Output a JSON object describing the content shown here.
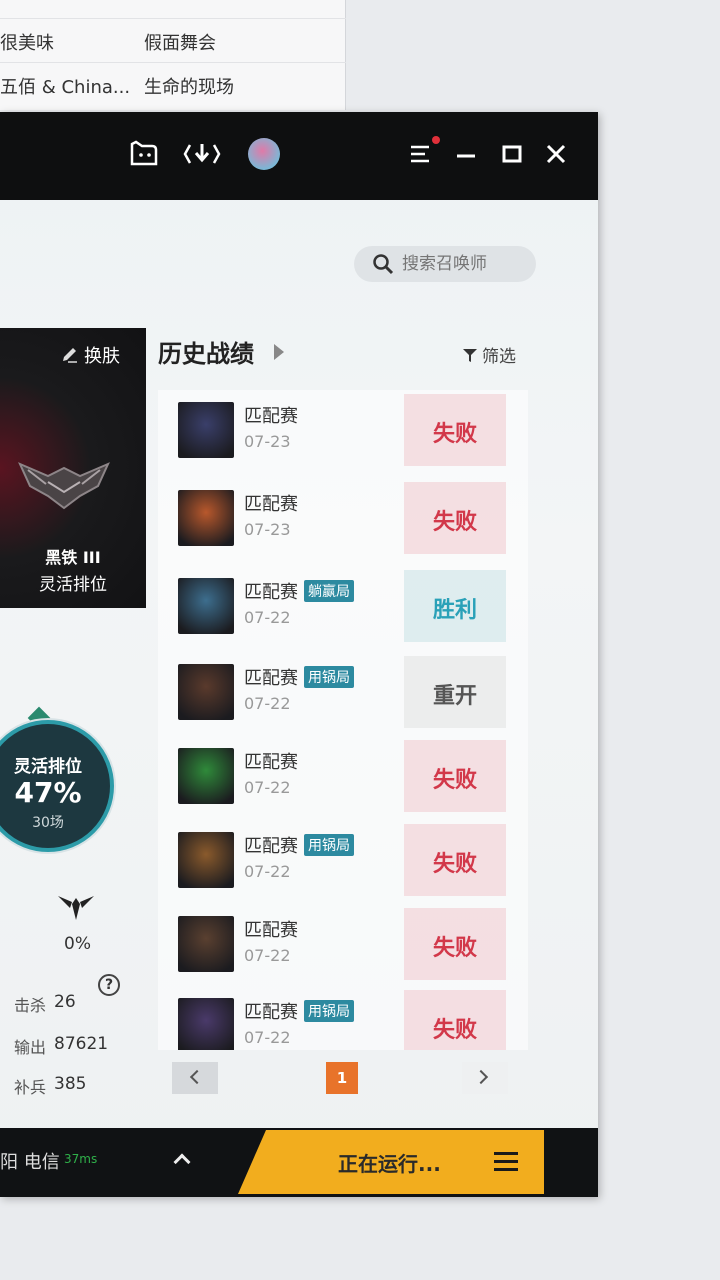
{
  "background_list": {
    "rows": [
      {
        "title": "",
        "album": ""
      },
      {
        "title": "很美味",
        "album": "假面舞会"
      },
      {
        "title": "五佰 & China...",
        "album": "生命的现场"
      }
    ]
  },
  "titlebar": {
    "icons": [
      "tv-icon",
      "download-icon",
      "avatar-icon",
      "menu-icon",
      "minimize-icon",
      "maximize-icon",
      "close-icon"
    ]
  },
  "search": {
    "placeholder": "搜索召唤师"
  },
  "rank_card": {
    "skin_button": "换肤",
    "tier": "黑铁 III",
    "queue": "灵活排位"
  },
  "winrate": {
    "label": "灵活排位",
    "value": "47%",
    "games": "30场"
  },
  "stats": {
    "pct": "0%",
    "rows": [
      {
        "key": "击杀",
        "value": "26"
      },
      {
        "key": "输出",
        "value": "87621"
      },
      {
        "key": "补兵",
        "value": "385"
      }
    ]
  },
  "history": {
    "title": "历史战绩",
    "filter": "筛选",
    "matches": [
      {
        "mode": "匹配赛",
        "tag": "",
        "date": "07-23",
        "result": "失败",
        "outcome": "loss",
        "color": "#3a3f6a"
      },
      {
        "mode": "匹配赛",
        "tag": "",
        "date": "07-23",
        "result": "失败",
        "outcome": "loss",
        "color": "#b8582c"
      },
      {
        "mode": "匹配赛",
        "tag": "躺赢局",
        "date": "07-22",
        "result": "胜利",
        "outcome": "win",
        "color": "#3d6e8e"
      },
      {
        "mode": "匹配赛",
        "tag": "用锅局",
        "date": "07-22",
        "result": "重开",
        "outcome": "remake",
        "color": "#5a3a2c"
      },
      {
        "mode": "匹配赛",
        "tag": "",
        "date": "07-22",
        "result": "失败",
        "outcome": "loss",
        "color": "#2f8a3a"
      },
      {
        "mode": "匹配赛",
        "tag": "用锅局",
        "date": "07-22",
        "result": "失败",
        "outcome": "loss",
        "color": "#8a5a2c"
      },
      {
        "mode": "匹配赛",
        "tag": "",
        "date": "07-22",
        "result": "失败",
        "outcome": "loss",
        "color": "#5a4030"
      },
      {
        "mode": "匹配赛",
        "tag": "用锅局",
        "date": "07-22",
        "result": "失败",
        "outcome": "loss",
        "color": "#4a3a6a"
      }
    ]
  },
  "pager": {
    "current": "1"
  },
  "footer": {
    "server": "阳 电信",
    "ping": "37ms",
    "run_label": "正在运行..."
  },
  "colors": {
    "loss": "#d2384a",
    "win": "#2aa1b8",
    "accent": "#f2ad1e",
    "page_current": "#e8732a"
  }
}
